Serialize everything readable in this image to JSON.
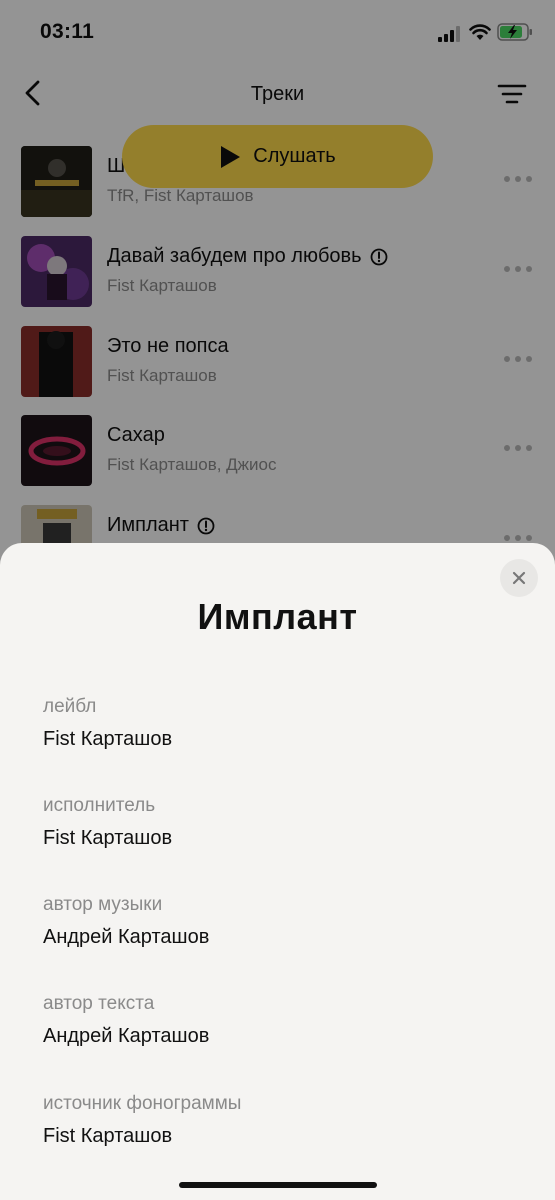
{
  "status": {
    "time": "03:11"
  },
  "header": {
    "title": "Треки"
  },
  "listen_button": {
    "label": "Слушать"
  },
  "tracks": [
    {
      "title": "Ш",
      "artist": "TfR, Fist Карташов",
      "explicit": false,
      "cover_color": "#2b2a22"
    },
    {
      "title": "Давай забудем про любовь",
      "artist": "Fist Карташов",
      "explicit": true,
      "cover_color": "#7a3a8c"
    },
    {
      "title": "Это не попса",
      "artist": "Fist Карташов",
      "explicit": false,
      "cover_color": "#7a2f2c"
    },
    {
      "title": "Сахар",
      "artist": "Fist Карташов, Джиос",
      "explicit": false,
      "cover_color": "#261620"
    },
    {
      "title": "Имплант",
      "artist": "",
      "explicit": true,
      "cover_color": "#cfc8b8"
    }
  ],
  "sheet": {
    "title": "Имплант",
    "fields": [
      {
        "label": "лейбл",
        "value": "Fist Карташов"
      },
      {
        "label": "исполнитель",
        "value": "Fist Карташов"
      },
      {
        "label": "автор музыки",
        "value": "Андрей Карташов"
      },
      {
        "label": "автор текста",
        "value": "Андрей Карташов"
      },
      {
        "label": "источник фонограммы",
        "value": "Fist Карташов"
      }
    ]
  },
  "colors": {
    "accent": "#ffdb4d",
    "sheet_bg": "#f5f4f2",
    "battery": "#4cd964"
  }
}
